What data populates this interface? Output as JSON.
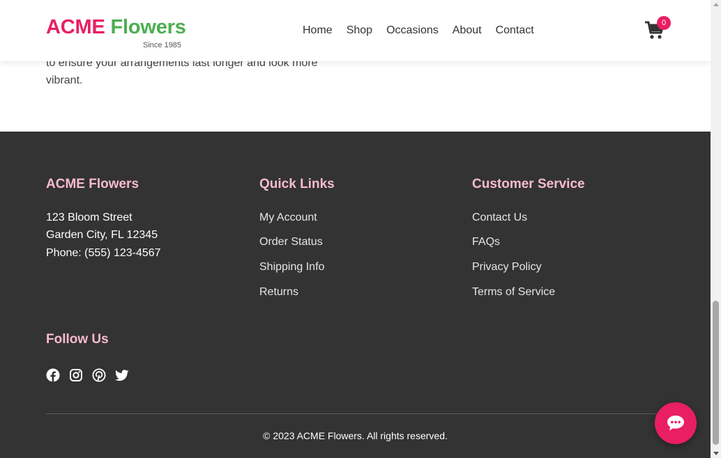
{
  "brand": {
    "name_part1": "ACME",
    "name_part2": "Flowers",
    "tagline": "Since 1985",
    "colors": {
      "primary_pink": "#e91e63",
      "primary_green": "#4caf50",
      "footer_heading": "#f8bbd0",
      "footer_bg": "#333333"
    }
  },
  "nav": {
    "items": [
      {
        "label": "Home"
      },
      {
        "label": "Shop"
      },
      {
        "label": "Occasions"
      },
      {
        "label": "About"
      },
      {
        "label": "Contact"
      }
    ]
  },
  "cart": {
    "icon": "cart-icon",
    "count": "0"
  },
  "article": {
    "line1": "to ensure your arrangements last longer and look more",
    "line2": "vibrant."
  },
  "footer": {
    "company": {
      "heading": "ACME Flowers",
      "address_line1": "123 Bloom Street",
      "address_line2": "Garden City, FL 12345",
      "phone": "Phone: (555) 123-4567"
    },
    "quick_links": {
      "heading": "Quick Links",
      "links": [
        "My Account",
        "Order Status",
        "Shipping Info",
        "Returns"
      ]
    },
    "customer_service": {
      "heading": "Customer Service",
      "links": [
        "Contact Us",
        "FAQs",
        "Privacy Policy",
        "Terms of Service"
      ]
    },
    "follow": {
      "heading": "Follow Us",
      "icons": [
        "facebook-icon",
        "instagram-icon",
        "pinterest-icon",
        "twitter-icon"
      ]
    },
    "copyright": "© 2023 ACME Flowers. All rights reserved."
  },
  "chat": {
    "icon": "chat-bubble-icon"
  }
}
